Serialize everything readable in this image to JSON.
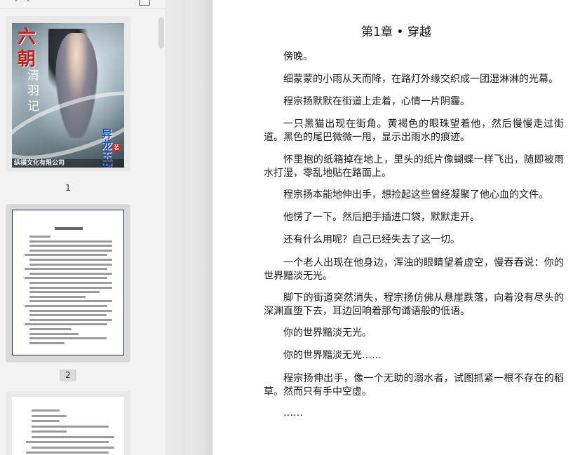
{
  "sidebar": {
    "thumbnails": [
      {
        "page_label": "1",
        "cover": {
          "title_chars": [
            "六",
            "朝"
          ],
          "title_small": [
            "清",
            "羽",
            "记"
          ],
          "author": [
            "异",
            "龙",
            "玉",
            "藏"
          ],
          "author_suffix": "著",
          "publisher": "纵横文化有限公司"
        }
      },
      {
        "page_label": "2"
      },
      {
        "page_label": ""
      }
    ]
  },
  "document": {
    "chapter_title": "第1章 • 穿越",
    "paragraphs": [
      "傍晚。",
      "细蒙蒙的小雨从天而降，在路灯外缘交织成一团湿淋淋的光幕。",
      "程宗扬默默在街道上走着，心情一片阴霾。",
      "一只黑猫出现在街角。黄褐色的眼珠望着他，然后慢慢走过街道。黑色的尾巴微微一甩，显示出雨水的痕迹。",
      "怀里抱的纸箱掉在地上，里头的纸片像蝴蝶一样飞出，随即被雨水打湿，零乱地贴在路面上。",
      "程宗扬本能地伸出手，想捡起这些曾经凝聚了他心血的文件。",
      "他愣了一下。然后把手插进口袋，默默走开。",
      "还有什么用呢？自己已经失去了这一切。",
      "一个老人出现在他身边，浑浊的眼睛望着虚空，慢吞吞说：你的世界黯淡无光。",
      "脚下的街道突然消失，程宗扬仿佛从悬崖跌落，向着没有尽头的深渊直堕下去，耳边回响着那句谶语般的低语。",
      "你的世界黯淡无光。",
      "你的世界黯淡无光……",
      "程宗扬伸出手，像一个无助的溺水者，试图抓紧一根不存在的稻草。然而只有手中空虚。",
      "……"
    ]
  },
  "colors": {
    "sidebar_bg": "#f3f3f3",
    "selected_thumb_bg": "#d9d9d9",
    "thumb_border": "#1e2a55",
    "gutter": "#e4e4e4",
    "page_bg": "#ffffff",
    "cover_title": "#c42020",
    "cover_author": "#1c4fb8"
  },
  "icons": [
    "sidebar-menu-icon",
    "edit-icon"
  ]
}
